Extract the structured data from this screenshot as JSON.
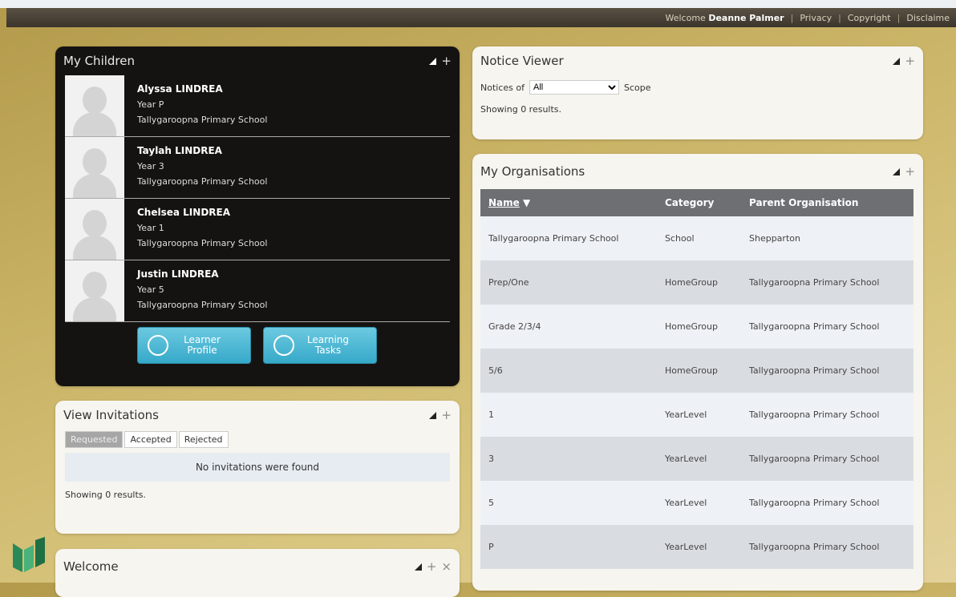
{
  "topbar": {
    "welcome_prefix": "Welcome",
    "user": "Deanne Palmer",
    "links": [
      "Privacy",
      "Copyright",
      "Disclaime"
    ]
  },
  "children_panel": {
    "title": "My Children",
    "children": [
      {
        "name": "Alyssa LINDREA",
        "year": "Year P",
        "school": "Tallygaroopna Primary School"
      },
      {
        "name": "Taylah LINDREA",
        "year": "Year 3",
        "school": "Tallygaroopna Primary School"
      },
      {
        "name": "Chelsea LINDREA",
        "year": "Year 1",
        "school": "Tallygaroopna Primary School"
      },
      {
        "name": "Justin LINDREA",
        "year": "Year 5",
        "school": "Tallygaroopna Primary School"
      }
    ],
    "buttons": {
      "learner_profile_l1": "Learner",
      "learner_profile_l2": "Profile",
      "learning_tasks_l1": "Learning",
      "learning_tasks_l2": "Tasks"
    }
  },
  "invitations_panel": {
    "title": "View Invitations",
    "tabs": [
      "Requested",
      "Accepted",
      "Rejected"
    ],
    "empty": "No invitations were found",
    "summary": "Showing 0 results."
  },
  "welcome_panel": {
    "title": "Welcome"
  },
  "notice_panel": {
    "title": "Notice Viewer",
    "notices_label": "Notices of",
    "selected": "All",
    "scope_label": "Scope",
    "summary": "Showing 0 results."
  },
  "orgs_panel": {
    "title": "My Organisations",
    "columns": [
      "Name",
      "Category",
      "Parent Organisation"
    ],
    "sort_indicator": "▼",
    "rows": [
      {
        "name": "Tallygaroopna Primary School",
        "category": "School",
        "parent": "Shepparton"
      },
      {
        "name": "Prep/One",
        "category": "HomeGroup",
        "parent": "Tallygaroopna Primary School"
      },
      {
        "name": "Grade 2/3/4",
        "category": "HomeGroup",
        "parent": "Tallygaroopna Primary School"
      },
      {
        "name": "5/6",
        "category": "HomeGroup",
        "parent": "Tallygaroopna Primary School"
      },
      {
        "name": "1",
        "category": "YearLevel",
        "parent": "Tallygaroopna Primary School"
      },
      {
        "name": "3",
        "category": "YearLevel",
        "parent": "Tallygaroopna Primary School"
      },
      {
        "name": "5",
        "category": "YearLevel",
        "parent": "Tallygaroopna Primary School"
      },
      {
        "name": "P",
        "category": "YearLevel",
        "parent": "Tallygaroopna Primary School"
      }
    ]
  },
  "icons": {
    "collapse": "collapse-triangle-icon",
    "add": "plus-icon",
    "close": "close-x-icon",
    "accent": "#36a9c9"
  }
}
